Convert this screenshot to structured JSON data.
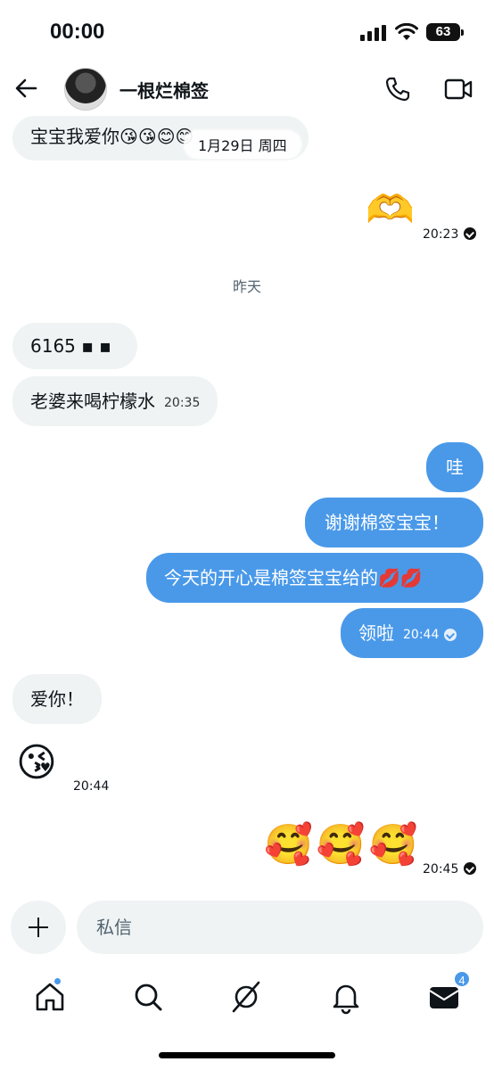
{
  "status_bar": {
    "time": "00:00",
    "battery": "63"
  },
  "header": {
    "contact_name": "一根烂棉签"
  },
  "messages": {
    "m1": {
      "text": "宝宝我爱你😘😘😊😊"
    },
    "date_divider": "1月29日 周四",
    "m2": {
      "emoji": "🫶",
      "time": "20:23"
    },
    "day_divider": "昨天",
    "m3": {
      "text": "6165 ▪ ▪"
    },
    "m4": {
      "text": "老婆来喝柠檬水",
      "time": "20:35"
    },
    "m5": {
      "text": "哇"
    },
    "m6": {
      "text": "谢谢棉签宝宝！"
    },
    "m7": {
      "text": "今天的开心是棉签宝宝给的💋💋"
    },
    "m8": {
      "text": "领啦",
      "time": "20:44"
    },
    "m9": {
      "text": "爱你！"
    },
    "m10": {
      "emoji": "😘",
      "time": "20:44"
    },
    "m11": {
      "emoji": "🥰🥰🥰",
      "time": "20:45"
    }
  },
  "composer": {
    "placeholder": "私信"
  },
  "nav": {
    "messages_badge": "4"
  },
  "colors": {
    "outgoing_bubble": "#4a99e9",
    "incoming_bubble": "#eff3f4",
    "accent": "#4a99e9"
  },
  "icons": [
    "back-arrow-icon",
    "phone-icon",
    "video-icon",
    "plus-icon",
    "home-icon",
    "search-icon",
    "grok-icon",
    "bell-icon",
    "mail-icon"
  ]
}
